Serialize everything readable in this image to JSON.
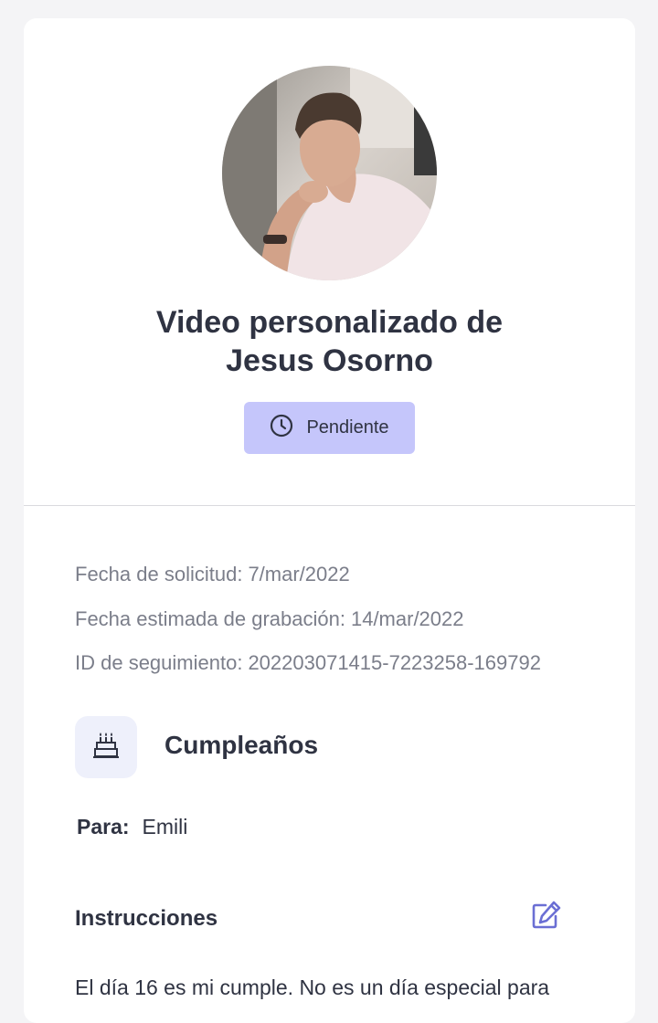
{
  "header": {
    "title_line1": "Video personalizado de",
    "title_line2": "Jesus Osorno",
    "avatar_alt": "Jesus Osorno"
  },
  "status": {
    "label": "Pendiente",
    "icon": "clock-icon",
    "badge_color": "#c5c6fb"
  },
  "details": {
    "request_date_label": "Fecha de solicitud:",
    "request_date": "7/mar/2022",
    "recording_date_label": "Fecha estimada de grabación:",
    "recording_date": "14/mar/2022",
    "tracking_id_label": "ID de seguimiento:",
    "tracking_id": "202203071415-7223258-169792"
  },
  "occasion": {
    "icon": "birthday-cake-icon",
    "title": "Cumpleaños"
  },
  "recipient": {
    "label": "Para:",
    "name": "Emili"
  },
  "instructions": {
    "title": "Instrucciones",
    "edit_icon": "edit-icon",
    "text": "El día 16 es mi cumple. No es un día especial para"
  },
  "colors": {
    "text_primary": "#2f3342",
    "text_secondary": "#7b7e8a",
    "accent": "#6b6fd4"
  }
}
